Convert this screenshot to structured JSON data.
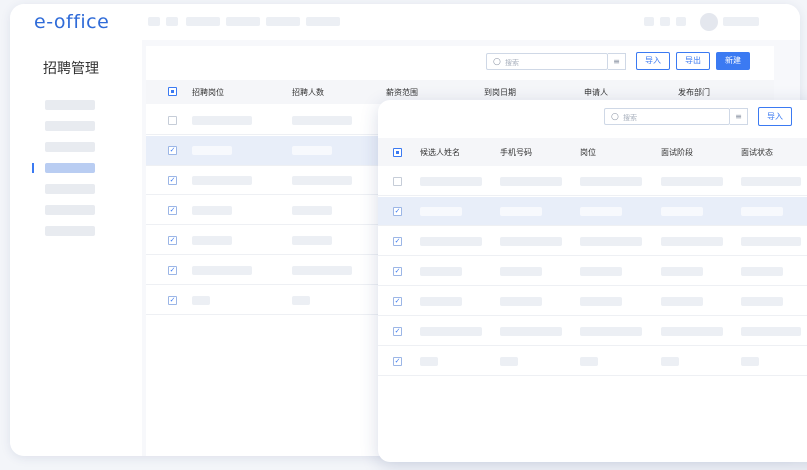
{
  "app": {
    "logo": "e-office"
  },
  "sidebar": {
    "title": "招聘管理"
  },
  "toolbar": {
    "search_placeholder": "搜索",
    "filter_icon": "filter-icon",
    "import_label": "导入",
    "export_label": "导出",
    "new_label": "新建"
  },
  "main_table": {
    "columns": [
      "招聘岗位",
      "招聘人数",
      "薪资范围",
      "到岗日期",
      "申请人",
      "发布部门"
    ]
  },
  "overlay": {
    "search_placeholder": "搜索",
    "import_label": "导入",
    "columns": [
      "候选人姓名",
      "手机号码",
      "岗位",
      "面试阶段",
      "面试状态"
    ]
  },
  "colors": {
    "accent": "#3b7af2",
    "logo": "#2f6bd8",
    "selected_row": "#e8eef9"
  }
}
